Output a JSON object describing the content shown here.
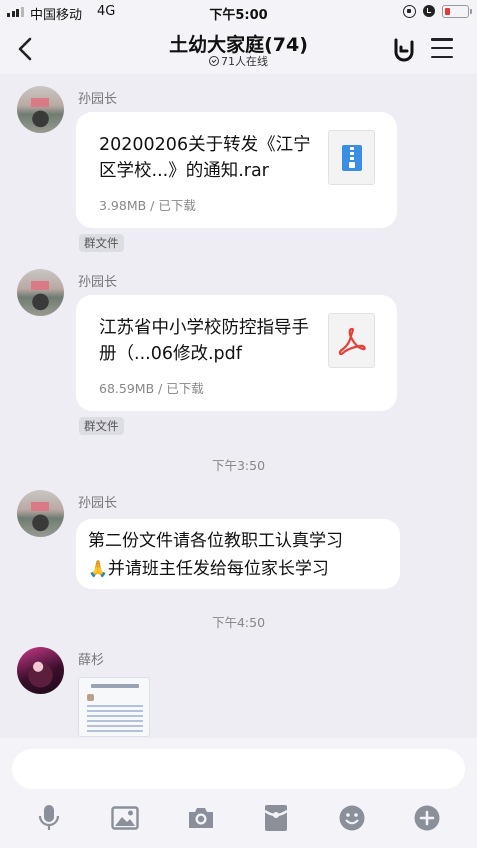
{
  "status_bar": {
    "carrier": "中国移动",
    "network": "4G",
    "time": "下午5:00",
    "battery_color": "#e53935"
  },
  "header": {
    "title": "土幼大家庭(74)",
    "online": "71人在线",
    "icons": [
      "chevron-left-icon",
      "rock-hand-icon",
      "menu-icon"
    ]
  },
  "messages": [
    {
      "sender": "孙园长",
      "type": "file",
      "file_name": "20200206关于转发《江宁区学校...》的通知.rar",
      "meta": "3.98MB / 已下载",
      "tag": "群文件",
      "icon": "zip-file-icon"
    },
    {
      "sender": "孙园长",
      "type": "file",
      "file_name": "江苏省中小学校防控指导手册（...06修改.pdf",
      "meta": "68.59MB / 已下载",
      "tag": "群文件",
      "icon": "pdf-file-icon"
    },
    {
      "type": "timestamp",
      "text": "下午3:50"
    },
    {
      "sender": "孙园长",
      "type": "text",
      "line1": "第二份文件请各位教职工认真学习",
      "emoji": "🙏",
      "line2": "并请班主任发给每位家长学习"
    },
    {
      "type": "timestamp",
      "text": "下午4:50"
    },
    {
      "sender": "薛杉",
      "type": "image"
    }
  ],
  "toolbar": [
    "microphone-icon",
    "image-icon",
    "camera-icon",
    "red-packet-icon",
    "emoji-icon",
    "plus-icon"
  ]
}
